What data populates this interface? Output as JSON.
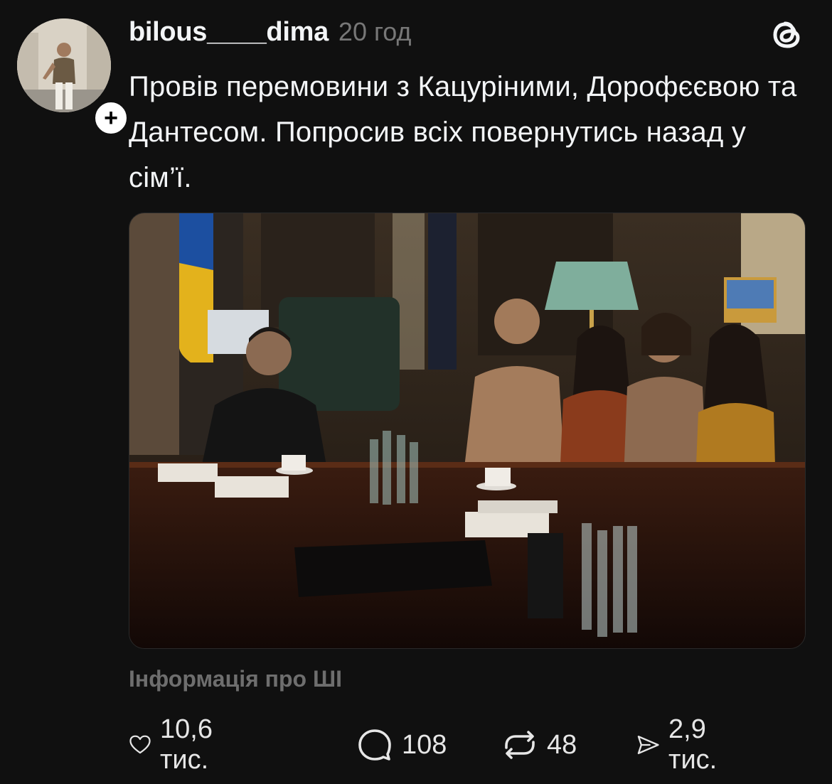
{
  "post": {
    "username": "bilous____dima",
    "timestamp": "20 год",
    "caption": "Провів перемовини з Кацуріними, Дорофєєвою та Дантесом. Попросив всіх повернутись назад у сім’ї.",
    "follow_symbol": "+",
    "ai_info_label": "Інформація про ШІ"
  },
  "actions": {
    "likes": "10,6 тис.",
    "replies": "108",
    "reposts": "48",
    "shares": "2,9 тис."
  },
  "icons": {
    "brand": "threads-logo-icon",
    "like": "heart-icon",
    "reply": "comment-bubble-icon",
    "repost": "repost-arrows-icon",
    "share": "send-icon"
  },
  "colors": {
    "background": "#101010",
    "text": "#f3f5f7",
    "muted": "#777777"
  }
}
